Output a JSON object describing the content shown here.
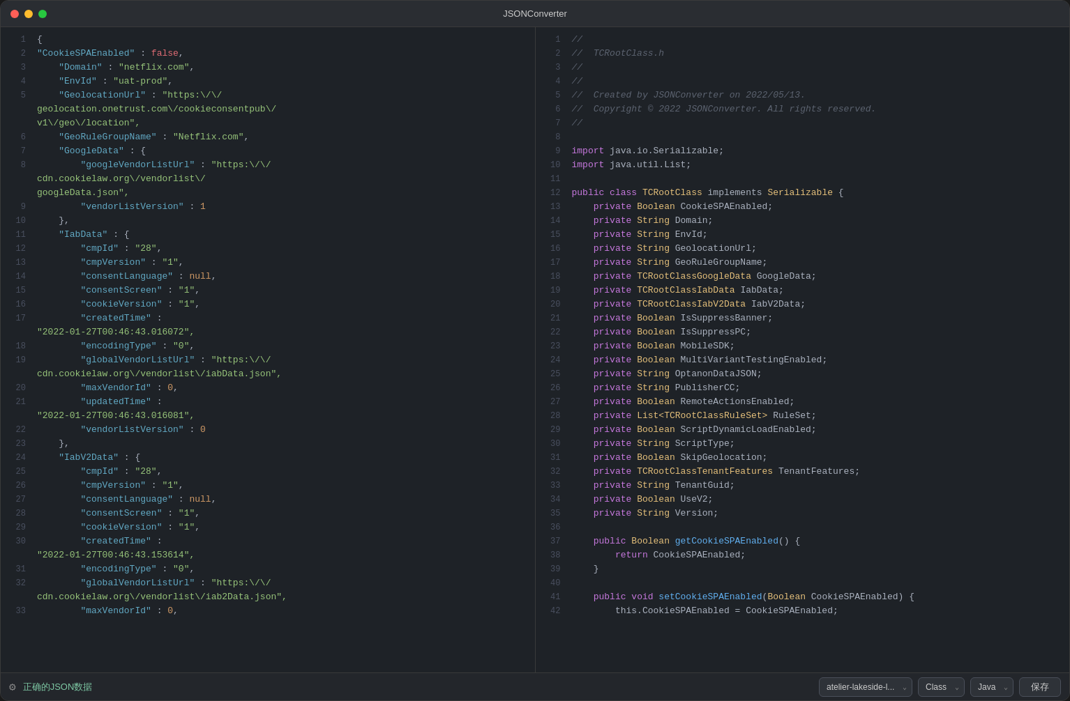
{
  "window": {
    "title": "JSONConverter"
  },
  "statusbar": {
    "valid_text": "正确的JSON数据",
    "dropdown1_value": "atelier-lakeside-l...",
    "dropdown2_value": "Class",
    "dropdown3_value": "Java",
    "save_label": "保存",
    "gear_icon": "⚙"
  },
  "left_pane": {
    "lines": [
      {
        "num": 1,
        "content": "{"
      },
      {
        "num": 2,
        "content": "    \"CookieSPAEnabled\" : false,"
      },
      {
        "num": 3,
        "content": "    \"Domain\" : \"netflix.com\","
      },
      {
        "num": 4,
        "content": "    \"EnvId\" : \"uat-prod\","
      },
      {
        "num": 5,
        "content": "    \"GeolocationUrl\" : \"https:\\/\\/"
      },
      {
        "num": "",
        "content": "geolocation.onetrust.com\\/cookieconsentpub\\/"
      },
      {
        "num": "",
        "content": "v1\\/geo\\/location\","
      },
      {
        "num": 6,
        "content": "    \"GeoRuleGroupName\" : \"Netflix.com\","
      },
      {
        "num": 7,
        "content": "    \"GoogleData\" : {"
      },
      {
        "num": 8,
        "content": "        \"googleVendorListUrl\" : \"https:\\/\\/"
      },
      {
        "num": "",
        "content": "cdn.cookielaw.org\\/vendorlist\\/"
      },
      {
        "num": "",
        "content": "googleData.json\","
      },
      {
        "num": 9,
        "content": "        \"vendorListVersion\" : 1"
      },
      {
        "num": 10,
        "content": "    },"
      },
      {
        "num": 11,
        "content": "    \"IabData\" : {"
      },
      {
        "num": 12,
        "content": "        \"cmpId\" : \"28\","
      },
      {
        "num": 13,
        "content": "        \"cmpVersion\" : \"1\","
      },
      {
        "num": 14,
        "content": "        \"consentLanguage\" : null,"
      },
      {
        "num": 15,
        "content": "        \"consentScreen\" : \"1\","
      },
      {
        "num": 16,
        "content": "        \"cookieVersion\" : \"1\","
      },
      {
        "num": 17,
        "content": "        \"createdTime\" :"
      },
      {
        "num": "",
        "content": "\"2022-01-27T00:46:43.016072\","
      },
      {
        "num": 18,
        "content": "        \"encodingType\" : \"0\","
      },
      {
        "num": 19,
        "content": "        \"globalVendorListUrl\" : \"https:\\/\\/"
      },
      {
        "num": "",
        "content": "cdn.cookielaw.org\\/vendorlist\\/iabData.json\","
      },
      {
        "num": 20,
        "content": "        \"maxVendorId\" : 0,"
      },
      {
        "num": 21,
        "content": "        \"updatedTime\" :"
      },
      {
        "num": "",
        "content": "\"2022-01-27T00:46:43.016081\","
      },
      {
        "num": 22,
        "content": "        \"vendorListVersion\" : 0"
      },
      {
        "num": 23,
        "content": "    },"
      },
      {
        "num": 24,
        "content": "    \"IabV2Data\" : {"
      },
      {
        "num": 25,
        "content": "        \"cmpId\" : \"28\","
      },
      {
        "num": 26,
        "content": "        \"cmpVersion\" : \"1\","
      },
      {
        "num": 27,
        "content": "        \"consentLanguage\" : null,"
      },
      {
        "num": 28,
        "content": "        \"consentScreen\" : \"1\","
      },
      {
        "num": 29,
        "content": "        \"cookieVersion\" : \"1\","
      },
      {
        "num": 30,
        "content": "        \"createdTime\" :"
      },
      {
        "num": "",
        "content": "\"2022-01-27T00:46:43.153614\","
      },
      {
        "num": 31,
        "content": "        \"encodingType\" : \"0\","
      },
      {
        "num": 32,
        "content": "        \"globalVendorListUrl\" : \"https:\\/\\/"
      },
      {
        "num": "",
        "content": "cdn.cookielaw.org\\/vendorlist\\/iab2Data.json\","
      },
      {
        "num": 33,
        "content": "        \"maxVendorId\" : 0,"
      }
    ]
  },
  "right_pane": {
    "lines": [
      {
        "num": 1,
        "content": "//"
      },
      {
        "num": 2,
        "content": "//  TCRootClass.h"
      },
      {
        "num": 3,
        "content": "//"
      },
      {
        "num": 4,
        "content": "//"
      },
      {
        "num": 5,
        "content": "//  Created by JSONConverter on 2022/05/13."
      },
      {
        "num": 6,
        "content": "//  Copyright © 2022 JSONConverter. All rights reserved."
      },
      {
        "num": 7,
        "content": "//"
      },
      {
        "num": 8,
        "content": ""
      },
      {
        "num": 9,
        "content": "import java.io.Serializable;"
      },
      {
        "num": 10,
        "content": "import java.util.List;"
      },
      {
        "num": 11,
        "content": ""
      },
      {
        "num": 12,
        "content": "public class TCRootClass implements Serializable {"
      },
      {
        "num": 13,
        "content": "    private Boolean CookieSPAEnabled;"
      },
      {
        "num": 14,
        "content": "    private String Domain;"
      },
      {
        "num": 15,
        "content": "    private String EnvId;"
      },
      {
        "num": 16,
        "content": "    private String GeolocationUrl;"
      },
      {
        "num": 17,
        "content": "    private String GeoRuleGroupName;"
      },
      {
        "num": 18,
        "content": "    private TCRootClassGoogleData GoogleData;"
      },
      {
        "num": 19,
        "content": "    private TCRootClassIabData IabData;"
      },
      {
        "num": 20,
        "content": "    private TCRootClassIabV2Data IabV2Data;"
      },
      {
        "num": 21,
        "content": "    private Boolean IsSuppressBanner;"
      },
      {
        "num": 22,
        "content": "    private Boolean IsSuppressPC;"
      },
      {
        "num": 23,
        "content": "    private Boolean MobileSDK;"
      },
      {
        "num": 24,
        "content": "    private Boolean MultiVariantTestingEnabled;"
      },
      {
        "num": 25,
        "content": "    private String OptanonDataJSON;"
      },
      {
        "num": 26,
        "content": "    private String PublisherCC;"
      },
      {
        "num": 27,
        "content": "    private Boolean RemoteActionsEnabled;"
      },
      {
        "num": 28,
        "content": "    private List<TCRootClassRuleSet> RuleSet;"
      },
      {
        "num": 29,
        "content": "    private Boolean ScriptDynamicLoadEnabled;"
      },
      {
        "num": 30,
        "content": "    private String ScriptType;"
      },
      {
        "num": 31,
        "content": "    private Boolean SkipGeolocation;"
      },
      {
        "num": 32,
        "content": "    private TCRootClassTenantFeatures TenantFeatures;"
      },
      {
        "num": 33,
        "content": "    private String TenantGuid;"
      },
      {
        "num": 34,
        "content": "    private Boolean UseV2;"
      },
      {
        "num": 35,
        "content": "    private String Version;"
      },
      {
        "num": 36,
        "content": ""
      },
      {
        "num": 37,
        "content": "    public Boolean getCookieSPAEnabled() {"
      },
      {
        "num": 38,
        "content": "        return CookieSPAEnabled;"
      },
      {
        "num": 39,
        "content": "    }"
      },
      {
        "num": 40,
        "content": ""
      },
      {
        "num": 41,
        "content": "    public void setCookieSPAEnabled(Boolean CookieSPAEnabled) {"
      },
      {
        "num": 42,
        "content": "        this.CookieSPAEnabled = CookieSPAEnabled;"
      }
    ]
  }
}
